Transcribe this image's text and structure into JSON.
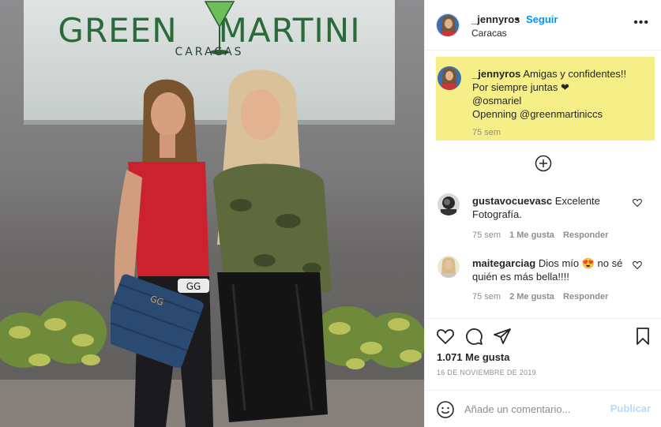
{
  "photo": {
    "sign_title_left": "GREEN",
    "sign_title_right": "MARTINI",
    "sign_subtitle": "CARACAS",
    "bag_logo": "GG",
    "belt_logo": "GG"
  },
  "header": {
    "username": "_jennyros",
    "separator": "•",
    "follow_label": "Seguir",
    "location": "Caracas",
    "more_icon": "more-options-icon",
    "more_text": "•••"
  },
  "caption": {
    "username": "_jennyros",
    "line1": "Amigas y confidentes!!",
    "line2": "Por siempre juntas ❤",
    "line3": "@osmariel",
    "line4": "Openning @greenmartiniccs",
    "time": "75 sem",
    "highlight_color": "#f6ee86"
  },
  "comments": [
    {
      "username": "gustavocuevasc",
      "text": "Excelente Fotografía.",
      "time": "75 sem",
      "likes": "1 Me gusta",
      "reply": "Responder"
    },
    {
      "username": "maitegarciag",
      "text": "Dios mío 😍 no sé quién es más bella!!!!",
      "time": "75 sem",
      "likes": "2 Me gusta",
      "reply": "Responder"
    }
  ],
  "actions": {
    "likes": "1.071 Me gusta",
    "date": "16 DE NOVIEMBRE DE 2019",
    "icons": [
      "heart-icon",
      "comment-icon",
      "share-icon",
      "bookmark-icon"
    ]
  },
  "add_comment": {
    "placeholder": "Añade un comentario...",
    "publish_label": "Publicar"
  },
  "colors": {
    "link": "#0095f6",
    "muted": "#8e8e8e",
    "publish_disabled": "#b3dbff"
  }
}
